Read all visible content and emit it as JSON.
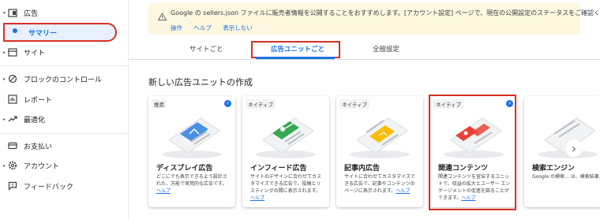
{
  "sidebar": {
    "items": [
      {
        "label": "広告",
        "icon": "ad-unit-icon"
      },
      {
        "label": "サマリー",
        "icon": "dot-icon"
      },
      {
        "label": "サイト",
        "icon": "web-icon"
      },
      {
        "label": "ブロックのコントロール",
        "icon": "block-icon"
      },
      {
        "label": "レポート",
        "icon": "report-icon"
      },
      {
        "label": "最適化",
        "icon": "trending-icon"
      },
      {
        "label": "お支払い",
        "icon": "payment-icon"
      },
      {
        "label": "アカウント",
        "icon": "gear-icon"
      },
      {
        "label": "フィードバック",
        "icon": "feedback-icon"
      }
    ]
  },
  "notice": {
    "message": "Google の sellers.json ファイルに販売者情報を公開することをおすすめします。[アカウント設定] ページで、現在の公開設定のステータスをご確認ください。",
    "links": [
      "操作",
      "ヘルプ",
      "表示しない"
    ]
  },
  "tabs": [
    {
      "label": "サイトごと"
    },
    {
      "label": "広告ユニットごと"
    },
    {
      "label": "全般設定"
    }
  ],
  "section_title": "新しい広告ユニットの作成",
  "cards": [
    {
      "badge": "推奨",
      "title": "ディスプレイ広告",
      "desc": "どこにでも表示できるよう設計された、万能で実用的な広告です。",
      "help": "ヘルプ"
    },
    {
      "badge": "ネイティブ",
      "title": "インフィード広告",
      "desc": "サイトのデザインに合わせてカスタマイズできる広告で、投稿とリスティングの間に表示されます。",
      "help": "ヘルプ"
    },
    {
      "badge": "ネイティブ",
      "title": "記事内広告",
      "desc": "サイトに合わせてカスタマイズできる広告で、記事やコンテンツのページに表示されます。",
      "help": "ヘルプ"
    },
    {
      "badge": "ネイティブ",
      "title": "関連コンテンツ",
      "desc": "関連コンテンツを宣伝するユニットで、収益の拡大とユーザー エンゲージメントの促進を図ることができます。",
      "help": "ヘルプ"
    },
    {
      "badge": "",
      "title": "検索エンジン",
      "desc": "Google の検索... は、検索結果...",
      "help": ""
    }
  ],
  "colors": {
    "accent": "#1a73e8",
    "highlight": "#d93025",
    "notice_bg": "#fef7e0"
  }
}
